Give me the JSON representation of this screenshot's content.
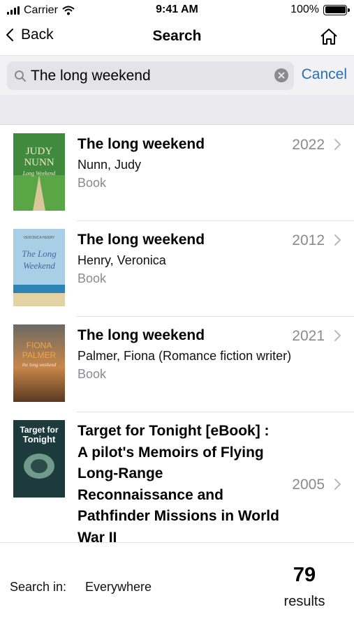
{
  "status_bar": {
    "carrier": "Carrier",
    "time": "9:41 AM",
    "battery": "100%"
  },
  "nav": {
    "back_label": "Back",
    "title": "Search"
  },
  "search": {
    "query": "The long weekend",
    "cancel_label": "Cancel"
  },
  "results": [
    {
      "title": "The long weekend",
      "author": "Nunn, Judy",
      "type": "Book",
      "year": "2022",
      "cover": {
        "top_text": "JUDY",
        "mid_text": "NUNN",
        "script_text": "Long Weekend",
        "bg": "#3f8a3c"
      }
    },
    {
      "title": "The long weekend",
      "author": "Henry, Veronica",
      "type": "Book",
      "year": "2012",
      "cover": {
        "top_text": "VERONICA HENRY",
        "mid_text": "",
        "script_text": "The Long Weekend",
        "bg": "#a9cfe6"
      }
    },
    {
      "title": "The long weekend",
      "author": "Palmer, Fiona (Romance fiction writer)",
      "type": "Book",
      "year": "2021",
      "cover": {
        "top_text": "FIONA",
        "mid_text": "PALMER",
        "script_text": "the long weekend",
        "bg": "#8a5a34"
      }
    },
    {
      "title": "Target for Tonight [eBook] : A pilot's Memoirs of Flying Long-Range Reconnaissance and Pathfinder Missions in World War II",
      "author": "",
      "type": "",
      "year": "2005",
      "cover": {
        "top_text": "Target for",
        "mid_text": "Tonight",
        "script_text": "",
        "bg": "#1d3a3c"
      }
    }
  ],
  "footer": {
    "search_in_label": "Search in:",
    "search_in_value": "Everywhere",
    "count": "79",
    "count_label": "results"
  },
  "colors": {
    "accent": "#2a6fb0",
    "secondary_text": "#8a8a8f"
  }
}
